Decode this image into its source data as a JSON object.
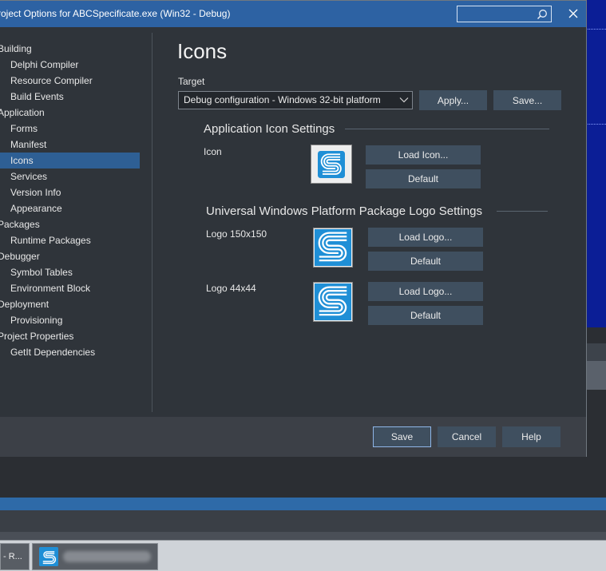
{
  "window": {
    "title": "roject Options for ABCSpecificate.exe  (Win32 - Debug)",
    "search_value": ""
  },
  "tree": {
    "items": [
      {
        "label": "Building",
        "level": 0
      },
      {
        "label": "Delphi Compiler",
        "level": 1
      },
      {
        "label": "Resource Compiler",
        "level": 1
      },
      {
        "label": "Build Events",
        "level": 1
      },
      {
        "label": "Application",
        "level": 0
      },
      {
        "label": "Forms",
        "level": 1
      },
      {
        "label": "Manifest",
        "level": 1
      },
      {
        "label": "Icons",
        "level": 1,
        "selected": true
      },
      {
        "label": "Services",
        "level": 1
      },
      {
        "label": "Version Info",
        "level": 1
      },
      {
        "label": "Appearance",
        "level": 1
      },
      {
        "label": "Packages",
        "level": 0
      },
      {
        "label": "Runtime Packages",
        "level": 1
      },
      {
        "label": "Debugger",
        "level": 0
      },
      {
        "label": "Symbol Tables",
        "level": 1
      },
      {
        "label": "Environment Block",
        "level": 1
      },
      {
        "label": "Deployment",
        "level": 0
      },
      {
        "label": "Provisioning",
        "level": 1
      },
      {
        "label": "Project Properties",
        "level": 0
      },
      {
        "label": "GetIt Dependencies",
        "level": 1
      }
    ]
  },
  "page": {
    "title": "Icons",
    "target_label": "Target",
    "target_value": "Debug configuration - Windows 32-bit platform",
    "apply_label": "Apply...",
    "save_label": "Save..."
  },
  "app_icon": {
    "section_title": "Application Icon Settings",
    "icon_label": "Icon",
    "load_label": "Load Icon...",
    "default_label": "Default"
  },
  "uwp": {
    "section_title": "Universal Windows Platform Package Logo Settings",
    "logo150_label": "Logo 150x150",
    "logo44_label": "Logo 44x44",
    "load_label": "Load Logo...",
    "default_label": "Default"
  },
  "footer": {
    "save_label": "Save",
    "cancel_label": "Cancel",
    "help_label": "Help"
  },
  "taskbar": {
    "first_label": "- R..."
  },
  "colors": {
    "titlebar": "#2d62a3",
    "dialog_bg": "#2f343a",
    "selection": "#2e5f94",
    "button": "#3f4f5f",
    "logo_blue": "#1f8fd6"
  }
}
